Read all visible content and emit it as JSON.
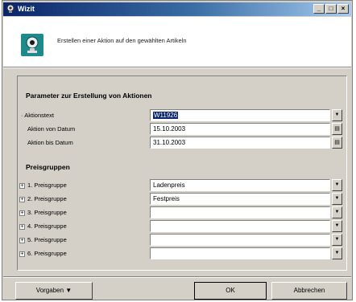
{
  "window": {
    "title": "Wizit",
    "controls": [
      "_",
      "□",
      "×"
    ]
  },
  "header": {
    "description": "Erstellen einer Aktion auf den gewählten Artikeln",
    "icon": "wizard-icon"
  },
  "params": {
    "title": "Parameter zur Erstellung von Aktionen",
    "rows": [
      {
        "label": "Aktionstext",
        "value": "W11926",
        "selected": true,
        "control": "dropdown"
      },
      {
        "label": "Aktion von Datum",
        "value": "15.10.2003",
        "control": "calendar"
      },
      {
        "label": "Aktion bis Datum",
        "value": "31.10.2003",
        "control": "calendar"
      }
    ]
  },
  "groups": {
    "title": "Preisgruppen",
    "rows": [
      {
        "label": "1. Preisgruppe",
        "value": "Ladenpreis"
      },
      {
        "label": "2. Preisgruppe",
        "value": "Festpreis"
      },
      {
        "label": "3. Preisgruppe",
        "value": ""
      },
      {
        "label": "4. Preisgruppe",
        "value": ""
      },
      {
        "label": "5. Preisgruppe",
        "value": ""
      },
      {
        "label": "6. Preisgruppe",
        "value": ""
      }
    ]
  },
  "footer": {
    "defaults_label": "Vorgaben ▼",
    "ok_label": "OK",
    "cancel_label": "Abbrechen"
  }
}
